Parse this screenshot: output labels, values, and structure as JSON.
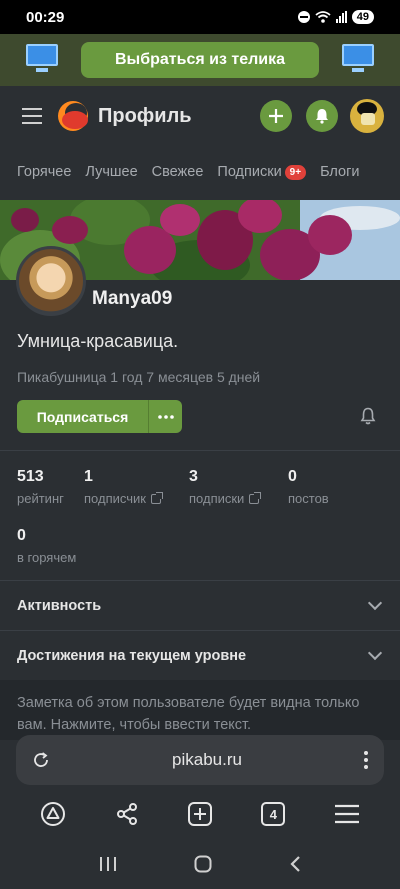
{
  "status_bar": {
    "time": "00:29",
    "battery": "49"
  },
  "promo": {
    "button_label": "Выбраться из телика"
  },
  "header": {
    "title": "Профиль"
  },
  "tabs": [
    {
      "label": "Горячее"
    },
    {
      "label": "Лучшее"
    },
    {
      "label": "Свежее"
    },
    {
      "label": "Подписки",
      "badge": "9+"
    },
    {
      "label": "Блоги"
    }
  ],
  "profile": {
    "username": "Manya09",
    "status": "Умница-красавица.",
    "since": "Пикабушница 1 год 7 месяцев 5 дней",
    "subscribe_label": "Подписаться"
  },
  "stats": [
    {
      "value": "513",
      "label": "рейтинг"
    },
    {
      "value": "1",
      "label": "подписчик"
    },
    {
      "value": "3",
      "label": "подписки"
    },
    {
      "value": "0",
      "label": "постов"
    },
    {
      "value": "0",
      "label": "в горячем"
    }
  ],
  "sections": [
    {
      "label": "Активность"
    },
    {
      "label": "Достижения на текущем уровне"
    }
  ],
  "note": {
    "text": "Заметка об этом пользователе будет видна только вам. Нажмите, чтобы ввести текст."
  },
  "browser": {
    "url": "pikabu.ru",
    "tab_count": "4"
  },
  "colors": {
    "accent": "#6a9a3f",
    "badge": "#e0413a",
    "background": "#2b2f33"
  }
}
